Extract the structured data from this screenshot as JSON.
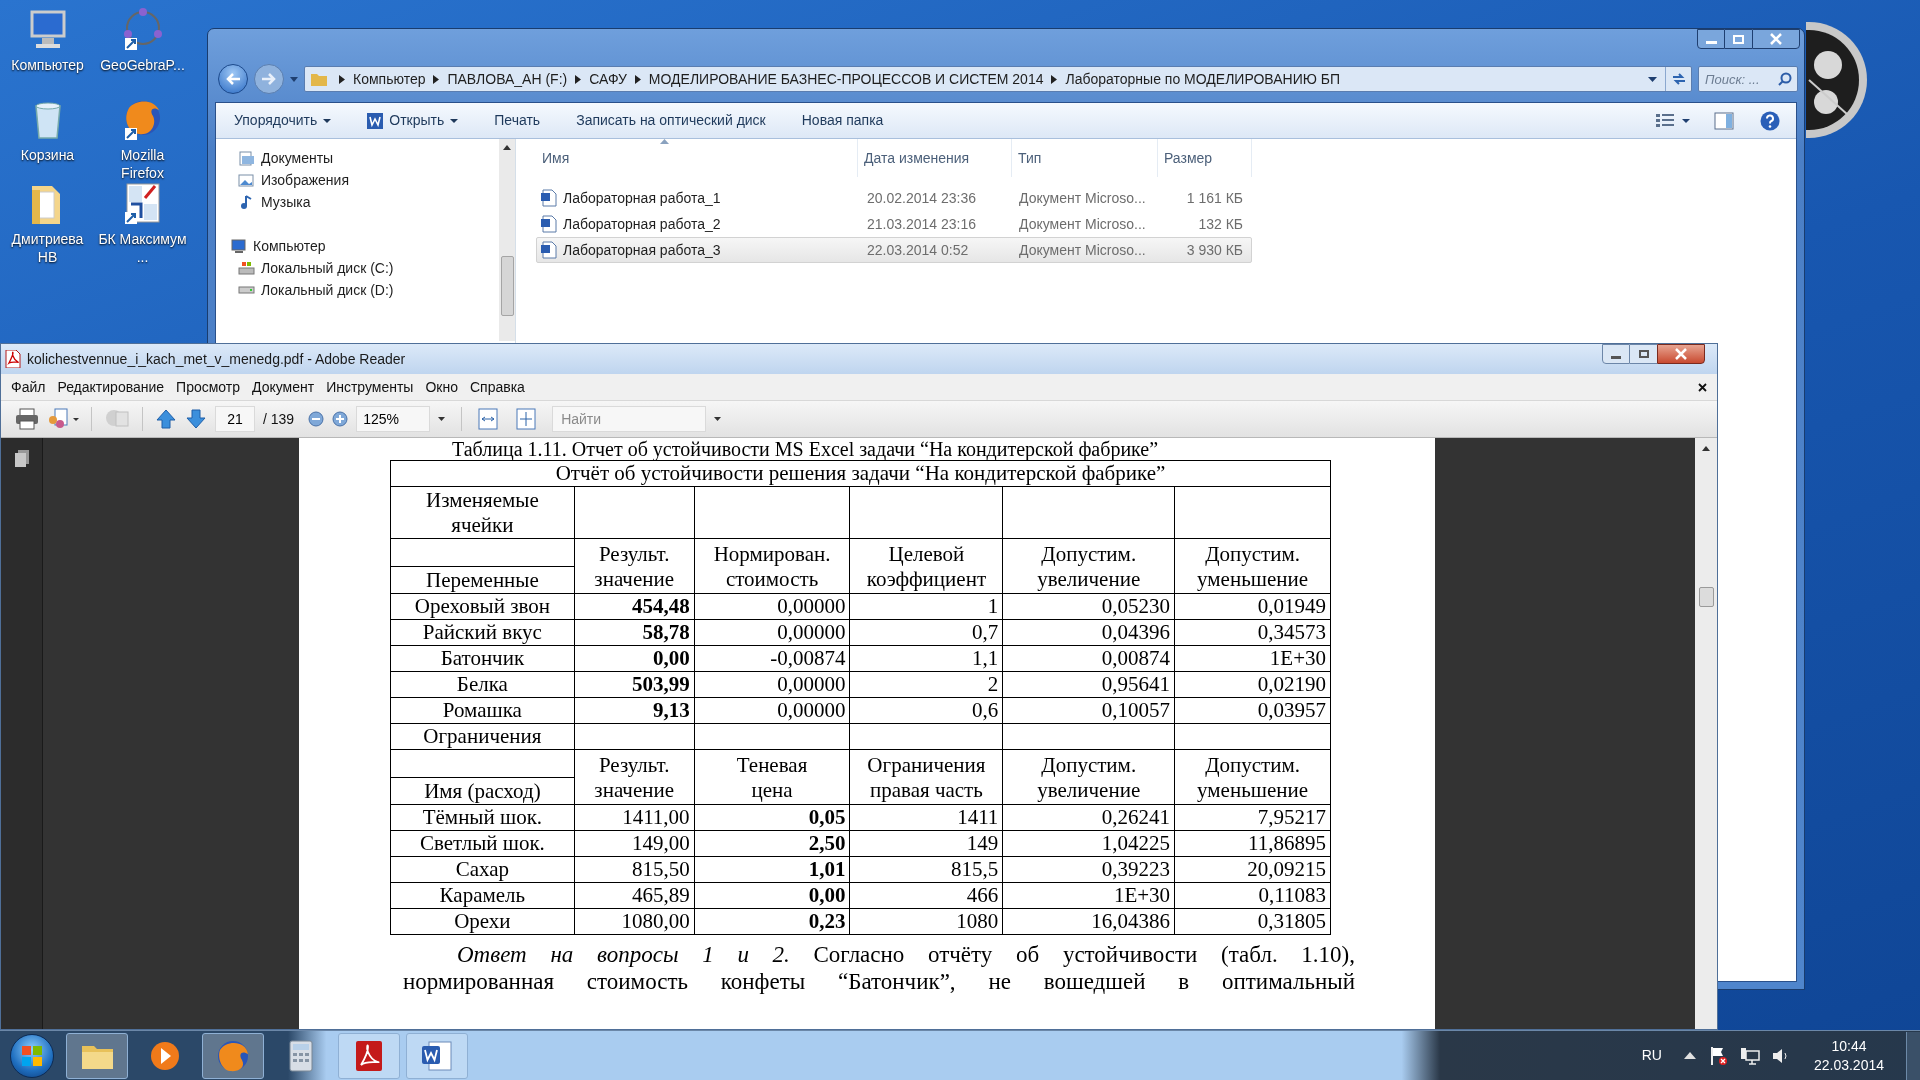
{
  "desktop": {
    "icons": [
      {
        "label": "Компьютер",
        "kind": "computer"
      },
      {
        "label": "GeoGebraP...",
        "kind": "geometry"
      },
      {
        "label": "Корзина",
        "kind": "bin"
      },
      {
        "label": "Mozilla Firefox",
        "kind": "browser"
      },
      {
        "label": "Дмитриева НВ",
        "kind": "folder"
      },
      {
        "label": "БК Максимум ...",
        "kind": "chart"
      }
    ]
  },
  "explorer": {
    "address": [
      "Компьютер",
      "ПАВЛОВА_АН (F:)",
      "САФУ",
      "МОДЕЛИРОВАНИЕ БАЗНЕС-ПРОЦЕССОВ И СИСТЕМ 2014",
      "Лабораторные по МОДЕЛИРОВАНИЮ БП"
    ],
    "search": {
      "placeholder": "Поиск: ..."
    },
    "toolbar": [
      {
        "label": "Упорядочить",
        "kind": "menu"
      },
      {
        "label": "Открыть",
        "kind": "open"
      },
      {
        "label": "Печать",
        "kind": "plain"
      },
      {
        "label": "Записать на оптический диск",
        "kind": "plain"
      },
      {
        "label": "Новая папка",
        "kind": "plain"
      }
    ],
    "nav": [
      {
        "label": "Документы",
        "kind": "documents"
      },
      {
        "label": "Изображения",
        "kind": "pictures"
      },
      {
        "label": "Музыка",
        "kind": "music"
      },
      {
        "label": "Компьютер",
        "kind": "computer"
      },
      {
        "label": "Локальный диск (C:)",
        "kind": "system-drive"
      },
      {
        "label": "Локальный диск (D:)",
        "kind": "drive"
      }
    ],
    "columns": [
      "Имя",
      "Дата изменения",
      "Тип",
      "Размер"
    ],
    "files": [
      {
        "name": "Лабораторная работа_1",
        "date": "20.02.2014 23:36",
        "type": "Документ Microso...",
        "size": "1 161 КБ",
        "selected": false
      },
      {
        "name": "Лабораторная работа_2",
        "date": "21.03.2014 23:16",
        "type": "Документ Microso...",
        "size": "132 КБ",
        "selected": false
      },
      {
        "name": "Лабораторная работа_3",
        "date": "22.03.2014 0:52",
        "type": "Документ Microso...",
        "size": "3 930 КБ",
        "selected": true
      }
    ]
  },
  "reader": {
    "title": "kolichestvennue_i_kach_met_v_menedg.pdf - Adobe Reader",
    "menu": [
      "Файл",
      "Редактирование",
      "Просмотр",
      "Документ",
      "Инструменты",
      "Окно",
      "Справка"
    ],
    "page": "21",
    "page_count": "/ 139",
    "zoom": "125%",
    "find": {
      "placeholder": "Найти"
    }
  },
  "document": {
    "caption": "Таблица 1.11. Отчет об устойчивости MS Excel задачи “На кондитерской фабрике”",
    "table": {
      "title": "Отчёт об устойчивости решения задачи “На кондитерской фабрике”",
      "sections": [
        {
          "label": "Изменяемые ячейки",
          "columns": [
            {
              "header": [
                "Переменные"
              ],
              "bold": false
            },
            {
              "header": [
                "Результ.",
                "значение"
              ],
              "bold": true
            },
            {
              "header": [
                "Нормирован.",
                "стоимость"
              ],
              "bold": false
            },
            {
              "header": [
                "Целевой",
                "коэффициент"
              ],
              "bold": false
            },
            {
              "header": [
                "Допустим.",
                "увеличение"
              ],
              "bold": false
            },
            {
              "header": [
                "Допустим.",
                "уменьшение"
              ],
              "bold": false
            }
          ],
          "rows": [
            [
              "Ореховый звон",
              "454,48",
              "0,00000",
              "1",
              "0,05230",
              "0,01949"
            ],
            [
              "Райский вкус",
              "58,78",
              "0,00000",
              "0,7",
              "0,04396",
              "0,34573"
            ],
            [
              "Батончик",
              "0,00",
              "-0,00874",
              "1,1",
              "0,00874",
              "1E+30"
            ],
            [
              "Белка",
              "503,99",
              "0,00000",
              "2",
              "0,95641",
              "0,02190"
            ],
            [
              "Ромашка",
              "9,13",
              "0,00000",
              "0,6",
              "0,10057",
              "0,03957"
            ]
          ]
        },
        {
          "label": "Ограничения",
          "columns": [
            {
              "header": [
                "Имя (расход)"
              ],
              "bold": false
            },
            {
              "header": [
                "Результ.",
                "значение"
              ],
              "bold": false
            },
            {
              "header": [
                "Теневая",
                "цена"
              ],
              "bold": true
            },
            {
              "header": [
                "Ограничения",
                "правая часть"
              ],
              "bold": false
            },
            {
              "header": [
                "Допустим.",
                "увеличение"
              ],
              "bold": false
            },
            {
              "header": [
                "Допустим.",
                "уменьшение"
              ],
              "bold": false
            }
          ],
          "rows": [
            [
              "Тёмный шок.",
              "1411,00",
              "0,05",
              "1411",
              "0,26241",
              "7,95217"
            ],
            [
              "Светлый шок.",
              "149,00",
              "2,50",
              "149",
              "1,04225",
              "11,86895"
            ],
            [
              "Сахар",
              "815,50",
              "1,01",
              "815,5",
              "0,39223",
              "20,09215"
            ],
            [
              "Карамель",
              "465,89",
              "0,00",
              "466",
              "1E+30",
              "0,11083"
            ],
            [
              "Орехи",
              "1080,00",
              "0,23",
              "1080",
              "16,04386",
              "0,31805"
            ]
          ]
        }
      ]
    },
    "paragraph": [
      "*Ответ на вопросы 1 и 2.* Согласно отчёту об устойчивости (табл. 1.10),",
      "нормированная стоимость конфеты “Батончик”, не вошедшей в оптимальный"
    ]
  },
  "taskbar": {
    "apps": [
      {
        "kind": "folder",
        "running": true
      },
      {
        "kind": "player",
        "running": false
      },
      {
        "kind": "browser",
        "running": true
      },
      {
        "kind": "calculator",
        "running": false
      },
      {
        "kind": "pdf",
        "running": true
      },
      {
        "kind": "word",
        "running": true
      }
    ],
    "language": "RU",
    "time": "10:44",
    "date": "22.03.2014"
  }
}
